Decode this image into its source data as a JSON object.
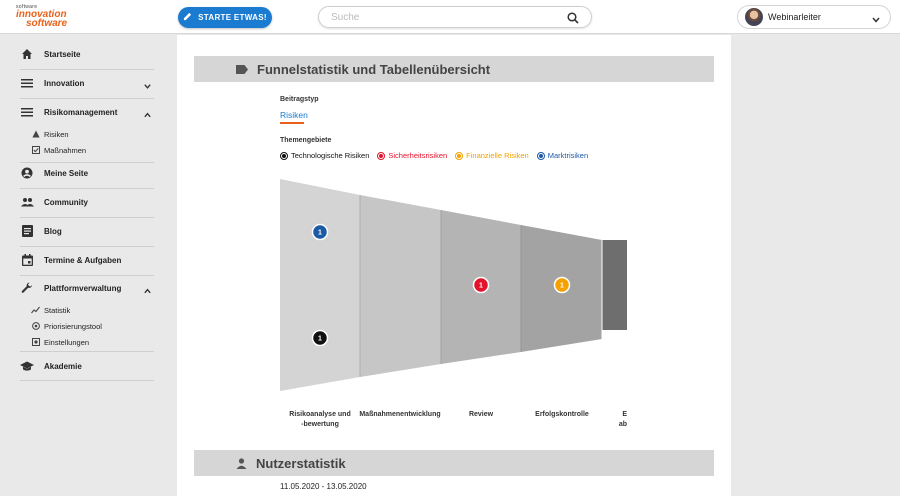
{
  "header": {
    "logo": {
      "small": "software",
      "line1": "innovation",
      "line2": "software"
    },
    "start_button": "STARTE ETWAS!",
    "search_placeholder": "Suche",
    "user_name": "Webinarleiter"
  },
  "sidebar": {
    "items": [
      {
        "label": "Startseite",
        "icon": "home-icon"
      },
      {
        "label": "Innovation",
        "icon": "menu-icon",
        "expandable": true,
        "expanded": false
      },
      {
        "label": "Risikomanagement",
        "icon": "menu-icon",
        "expandable": true,
        "expanded": true
      },
      {
        "label": "Meine Seite",
        "icon": "user-circle-icon"
      },
      {
        "label": "Community",
        "icon": "group-icon"
      },
      {
        "label": "Blog",
        "icon": "blog-icon"
      },
      {
        "label": "Termine & Aufgaben",
        "icon": "calendar-icon"
      },
      {
        "label": "Plattformverwaltung",
        "icon": "wrench-icon",
        "expandable": true,
        "expanded": true
      },
      {
        "label": "Akademie",
        "icon": "graduation-cap-icon"
      }
    ],
    "risk_sub": [
      {
        "label": "Risiken",
        "icon": "warning-icon"
      },
      {
        "label": "Maßnahmen",
        "icon": "checkbox-icon"
      }
    ],
    "platform_sub": [
      {
        "label": "Statistik",
        "icon": "trend-icon"
      },
      {
        "label": "Priorisierungstool",
        "icon": "target-icon"
      },
      {
        "label": "Einstellungen",
        "icon": "settings-square-icon"
      }
    ]
  },
  "main": {
    "funnel_title": "Funnelstatistik und Tabellenübersicht",
    "beitragstyp_label": "Beitragstyp",
    "beitragstyp_value": "Risiken",
    "themengebiete_label": "Themengebiete",
    "themes": [
      {
        "label": "Technologische Risiken",
        "color": "#111111"
      },
      {
        "label": "Sicherheitsrisiken",
        "color": "#e3132c"
      },
      {
        "label": "Finanzielle Risiken",
        "color": "#f5a100"
      },
      {
        "label": "Marktrisiken",
        "color": "#1c5aa6"
      }
    ],
    "stages": [
      {
        "line1": "Risikoanalyse und",
        "line2": "-bewertung"
      },
      {
        "line1": "Maßnahmenentwicklung",
        "line2": ""
      },
      {
        "line1": "Review",
        "line2": ""
      },
      {
        "line1": "Erfolgskontrolle",
        "line2": ""
      },
      {
        "line1": "E",
        "line2": "ab"
      }
    ],
    "markers": [
      {
        "stage": 0,
        "theme": "Marktrisiken",
        "count": "1"
      },
      {
        "stage": 0,
        "theme": "Technologische Risiken",
        "count": "1"
      },
      {
        "stage": 2,
        "theme": "Sicherheitsrisiken",
        "count": "1"
      },
      {
        "stage": 3,
        "theme": "Finanzielle Risiken",
        "count": "1"
      }
    ],
    "user_stats_title": "Nutzerstatistik",
    "date_range": "11.05.2020 - 13.05.2020"
  }
}
